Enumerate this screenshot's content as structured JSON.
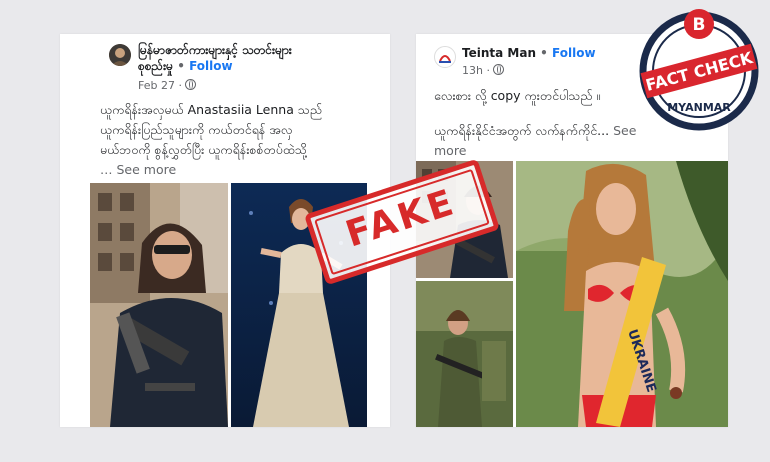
{
  "left_post": {
    "page_name_line1": "မြန်မာဇာတ်ကားများနှင့် သတင်းများ",
    "page_name_line2": "စုစည်းမှု",
    "follow_label": "Follow",
    "date": "Feb 27",
    "text_line1": "ယူကရိန်းအလှမယ် Anastasiia Lenna သည်",
    "text_line2": "ယူကရိန်းပြည်သူများကို ကယ်တင်ရန် အလှ",
    "text_line3": "မယ်ဘဝကို စွန့်လွှတ်ပြီး ယူကရိန်းစစ်တပ်ထဲသို့",
    "see_more": "… See more"
  },
  "right_post": {
    "page_name": "Teinta Man",
    "follow_label": "Follow",
    "time": "13h",
    "text_line1": "လေးစား လို့ copy ကူးတင်ပါသည် ။",
    "text_line2": "ယူကရိန်းနိုင်ငံအတွက် လက်နက်ကိုင်...",
    "see_more_1": "See",
    "see_more_2": "more",
    "sash_text": "UKRAINE"
  },
  "stamp": {
    "label": "FAKE"
  },
  "badge": {
    "letter": "B",
    "top_text": "FACT CHECK",
    "bottom_text": "MYANMAR"
  },
  "colors": {
    "follow": "#1877f2",
    "stamp_red": "#d72a2a",
    "badge_navy": "#1b2a4a",
    "badge_red": "#d9262e"
  }
}
